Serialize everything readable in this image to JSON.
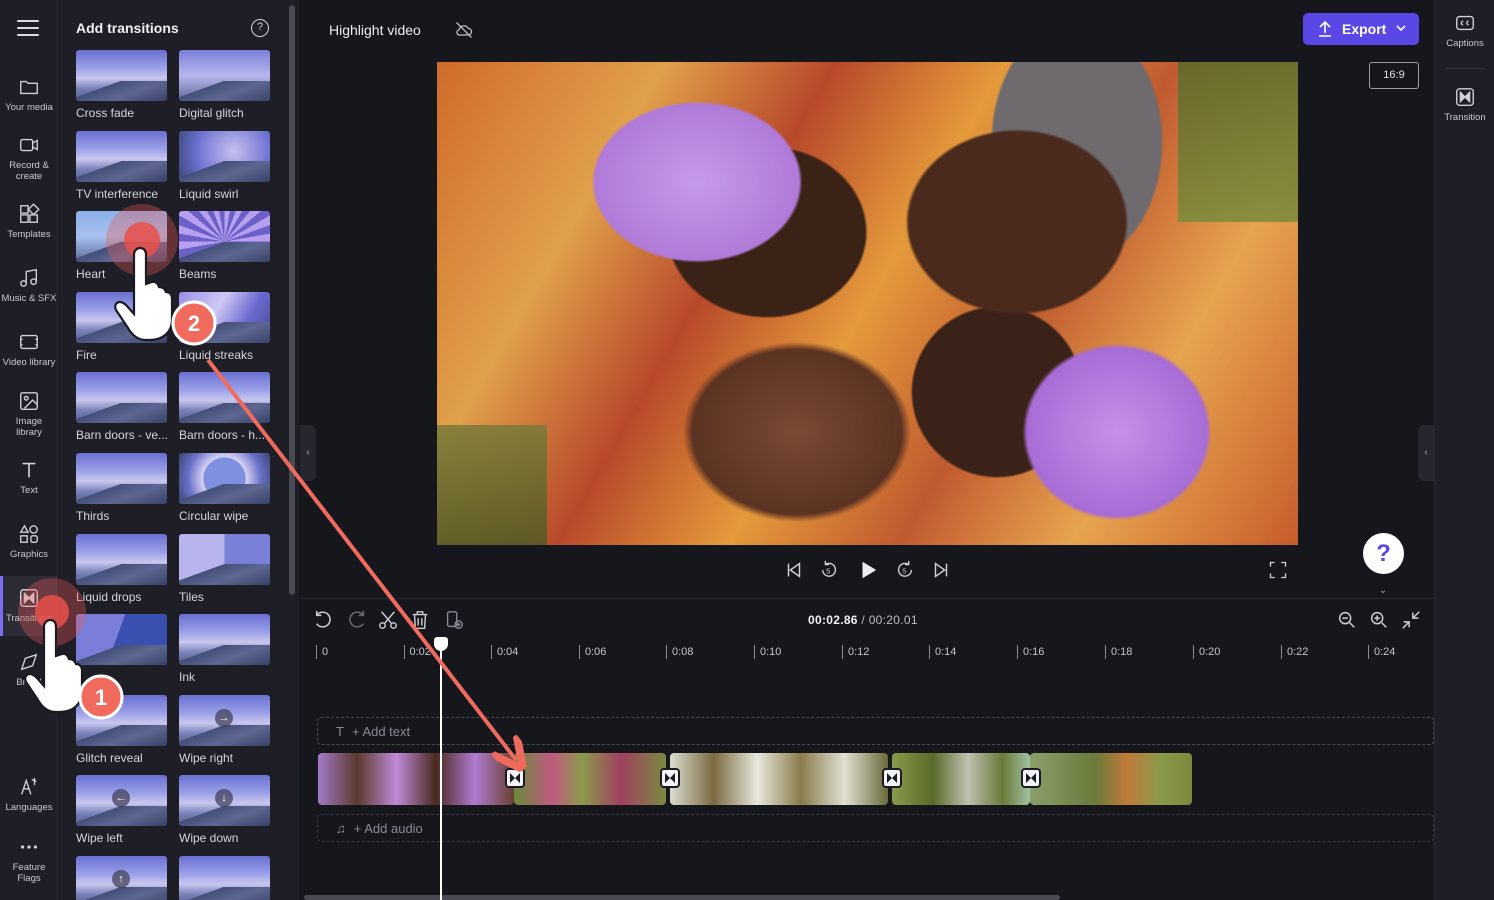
{
  "rail": {
    "items": [
      {
        "label": "Your media",
        "icon": "folder-icon"
      },
      {
        "label": "Record & create",
        "icon": "camera-icon"
      },
      {
        "label": "Templates",
        "icon": "templates-icon"
      },
      {
        "label": "Music & SFX",
        "icon": "music-icon"
      },
      {
        "label": "Video library",
        "icon": "film-icon"
      },
      {
        "label": "Image library",
        "icon": "image-icon"
      },
      {
        "label": "Text",
        "icon": "text-icon"
      },
      {
        "label": "Graphics",
        "icon": "shapes-icon"
      },
      {
        "label": "Transitions",
        "icon": "transition-icon"
      },
      {
        "label": "Brand",
        "icon": "brand-icon"
      },
      {
        "label": "Languages",
        "icon": "languages-icon"
      },
      {
        "label": "Feature Flags",
        "icon": "more-icon"
      }
    ]
  },
  "panel": {
    "title": "Add transitions",
    "tiles": [
      {
        "label": "Cross fade"
      },
      {
        "label": "Digital glitch"
      },
      {
        "label": "TV interference"
      },
      {
        "label": "Liquid swirl"
      },
      {
        "label": "Heart"
      },
      {
        "label": "Beams"
      },
      {
        "label": "Fire"
      },
      {
        "label": "Liquid streaks"
      },
      {
        "label": "Barn doors - ve..."
      },
      {
        "label": "Barn doors - h..."
      },
      {
        "label": "Thirds"
      },
      {
        "label": "Circular wipe"
      },
      {
        "label": "Liquid drops"
      },
      {
        "label": "Tiles"
      },
      {
        "label": ""
      },
      {
        "label": "Ink"
      },
      {
        "label": "Glitch reveal"
      },
      {
        "label": "Wipe right"
      },
      {
        "label": "Wipe left"
      },
      {
        "label": "Wipe down"
      },
      {
        "label": ""
      },
      {
        "label": ""
      }
    ]
  },
  "topbar": {
    "project_title": "Highlight video",
    "export_label": "Export",
    "aspect_ratio": "16:9"
  },
  "right_rail": {
    "captions": "Captions",
    "transition": "Transition"
  },
  "timeline": {
    "current_time": "00:02.86",
    "total_time": "/ 00:20.01",
    "ruler": [
      "0",
      "0:02",
      "0:04",
      "0:06",
      "0:08",
      "0:10",
      "0:12",
      "0:14",
      "0:16",
      "0:18",
      "0:20",
      "0:22",
      "0:24"
    ],
    "add_text": "+ Add text",
    "add_audio": "+ Add audio"
  },
  "annotations": {
    "step1": "1",
    "step2": "2"
  },
  "colors": {
    "accent": "#5a48e6",
    "annotation": "#f06b5e"
  }
}
